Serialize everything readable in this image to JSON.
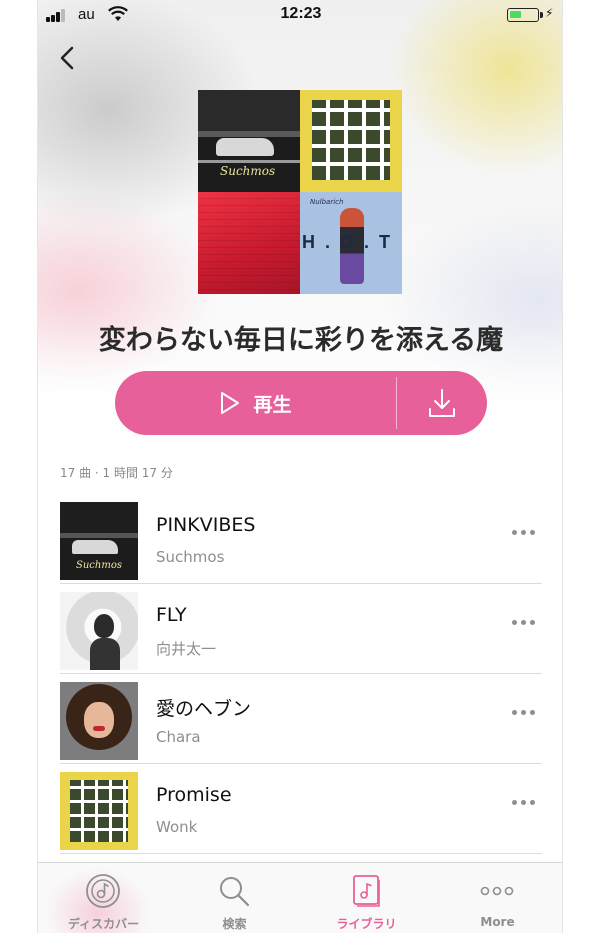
{
  "status_bar": {
    "carrier": "au",
    "time": "12:23",
    "battery_level": 0.45
  },
  "nav": {
    "back_icon": "chevron-left-icon"
  },
  "playlist": {
    "title": "変わらない毎日に彩りを添える魔",
    "meta": "17 曲 · 1 時間 17 分",
    "play_label": "再生",
    "download_icon": "download-icon"
  },
  "tracks": [
    {
      "title": "PINKVIBES",
      "artist": "Suchmos"
    },
    {
      "title": "FLY",
      "artist": "向井太一"
    },
    {
      "title": "愛のヘブン",
      "artist": "Chara"
    },
    {
      "title": "Promise",
      "artist": "Wonk"
    }
  ],
  "tabs": [
    {
      "label": "ディスカバー",
      "icon": "discover-icon",
      "active": false
    },
    {
      "label": "検索",
      "icon": "search-icon",
      "active": false
    },
    {
      "label": "ライブラリ",
      "icon": "library-icon",
      "active": true
    },
    {
      "label": "More",
      "icon": "more-icon",
      "active": false
    }
  ],
  "colors": {
    "accent": "#e8609a",
    "inactive": "#8e8e93",
    "battery": "#4cd964"
  }
}
